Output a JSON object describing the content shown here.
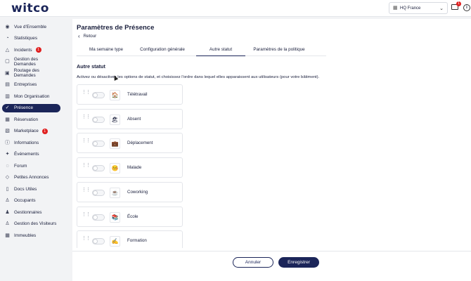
{
  "app": {
    "logo": "witco",
    "building": "HQ France",
    "mail_badge": "1"
  },
  "sidebar": {
    "items": [
      {
        "label": "Vue d'Ensemble",
        "icon": "eye-icon"
      },
      {
        "label": "Statistiques",
        "icon": "chart-icon"
      },
      {
        "label": "Incidents",
        "icon": "warning-icon",
        "badge": "1"
      },
      {
        "label": "Gestion des Demandes",
        "icon": "inbox-icon"
      },
      {
        "label": "Routage des Demandes",
        "icon": "route-icon"
      },
      {
        "label": "Entreprises",
        "icon": "briefcase-icon"
      },
      {
        "label": "Mon Organisation",
        "icon": "org-icon"
      },
      {
        "label": "Présence",
        "icon": "check-circle-icon",
        "active": true
      },
      {
        "label": "Réservation",
        "icon": "calendar-icon"
      },
      {
        "label": "Marketplace",
        "icon": "store-icon",
        "badge": "1"
      },
      {
        "label": "Informations",
        "icon": "info-icon"
      },
      {
        "label": "Événements",
        "icon": "event-icon"
      },
      {
        "label": "Forum",
        "icon": "chat-icon"
      },
      {
        "label": "Petites Annonces",
        "icon": "tag-icon"
      },
      {
        "label": "Docs Utiles",
        "icon": "doc-icon"
      },
      {
        "label": "Occupants",
        "icon": "user-icon"
      },
      {
        "label": "Gestionnaires",
        "icon": "manager-icon"
      },
      {
        "label": "Gestion des Visiteurs",
        "icon": "visitor-icon"
      },
      {
        "label": "Immeubles",
        "icon": "building-icon"
      }
    ]
  },
  "page": {
    "title": "Paramètres de Présence",
    "back_label": "Retour"
  },
  "tabs": [
    {
      "label": "Ma semaine type",
      "active": false
    },
    {
      "label": "Configuration générale",
      "active": false
    },
    {
      "label": "Autre statut",
      "active": true
    },
    {
      "label": "Paramètres de la politique",
      "active": false
    }
  ],
  "section": {
    "title": "Autre statut",
    "description": "Activez ou désactivez les options de statut, et choisissez l'ordre dans lequel elles apparaissent aux utilisateurs (pour votre bâtiment)."
  },
  "statuses": [
    {
      "label": "Télétravail",
      "emoji": "🏠",
      "enabled": false
    },
    {
      "label": "Absent",
      "emoji": "🏖",
      "enabled": false
    },
    {
      "label": "Déplacement",
      "emoji": "💼",
      "enabled": false
    },
    {
      "label": "Malade",
      "emoji": "🤒",
      "enabled": false
    },
    {
      "label": "Coworking",
      "emoji": "☕",
      "enabled": false
    },
    {
      "label": "École",
      "emoji": "📚",
      "enabled": false
    },
    {
      "label": "Formation",
      "emoji": "✍",
      "enabled": false
    }
  ],
  "footer": {
    "cancel_label": "Annuler",
    "save_label": "Enregistrer"
  },
  "colors": {
    "primary": "#1b2559",
    "badge": "#e02020",
    "background": "#f2f3f5"
  }
}
